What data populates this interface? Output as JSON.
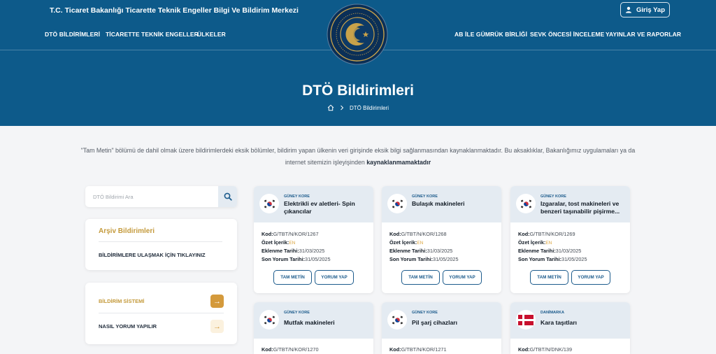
{
  "header": {
    "site_title": "T.C. Ticaret Bakanlığı Ticarette Teknik Engeller Bilgi Ve Bildirim Merkezi",
    "login_label": "Giriş Yap",
    "nav_left": [
      "DTÖ BİLDİRİMLERİ",
      "TİCARETTE TEKNİK ENGELLER",
      "ÜLKELER"
    ],
    "nav_right": [
      "AB İLE GÜMRÜK BİRLİĞİ",
      "SEVK ÖNCESİ İNCELEME",
      "YAYINLAR VE RAPORLAR"
    ]
  },
  "hero": {
    "title": "DTÖ Bildirimleri",
    "breadcrumb": [
      "DTÖ Bildirimleri"
    ]
  },
  "notice": {
    "text": "\"Tam Metin\" bölümü de dahil olmak üzere bildirimlerdeki eksik bölümler, bildirim yapan ülkenin veri girişinde eksik bilgi sağlanmasından kaynaklanmaktadır. Bu aksaklıklar, Bakanlığımız uygulamaları ya da internet sitemizin işleyişinden ",
    "emphasis": "kaynaklanmamaktadır"
  },
  "sidebar": {
    "search_placeholder": "DTÖ Bildirimi Ara",
    "archive_title": "Arşiv Bildirimleri",
    "archive_link": "BİLDİRİMLERE ULAŞMAK İÇİN TIKLAYINIZ",
    "links": [
      "BİLDİRİM SİSTEMİ",
      "NASIL YORUM YAPILIR"
    ]
  },
  "labels": {
    "kod": "Kod:",
    "ozet": "Özet İçerik:",
    "eklenme": "Eklenme Tarihi:",
    "son_yorum": "Son Yorum Tarihi:",
    "full_text": "TAM METİN",
    "comment": "YORUM YAP"
  },
  "colors": {
    "primary": "#0d5a8a",
    "accent": "#c49a3c",
    "card_head": "#e4ebf2"
  },
  "notifications": [
    {
      "country": "GÜNEY KORE",
      "flag": "korea-flag-icon",
      "title": "Elektrikli ev aletleri- Spin çıkancılar",
      "code": "G/TBT/N/KOR/1267",
      "lang": "EN",
      "added": "31/03/2025",
      "deadline": "31/05/2025"
    },
    {
      "country": "GÜNEY KORE",
      "flag": "korea-flag-icon",
      "title": "Bulaşık makineleri",
      "code": "G/TBT/N/KOR/1268",
      "lang": "EN",
      "added": "31/03/2025",
      "deadline": "31/05/2025"
    },
    {
      "country": "GÜNEY KORE",
      "flag": "korea-flag-icon",
      "title": "Izgaralar, tost makineleri ve benzeri taşınabilir pişirme...",
      "code": "G/TBT/N/KOR/1269",
      "lang": "EN",
      "added": "31/03/2025",
      "deadline": "31/05/2025"
    },
    {
      "country": "GÜNEY KORE",
      "flag": "korea-flag-icon",
      "title": "Mutfak makineleri",
      "code": "G/TBT/N/KOR/1270"
    },
    {
      "country": "GÜNEY KORE",
      "flag": "korea-flag-icon",
      "title": "Pil şarj cihazları",
      "code": "G/TBT/N/KOR/1271"
    },
    {
      "country": "DANİMARKA",
      "flag": "denmark-flag-icon",
      "title": "Kara taşıtları",
      "code": "G/TBT/N/DNK/139"
    }
  ]
}
